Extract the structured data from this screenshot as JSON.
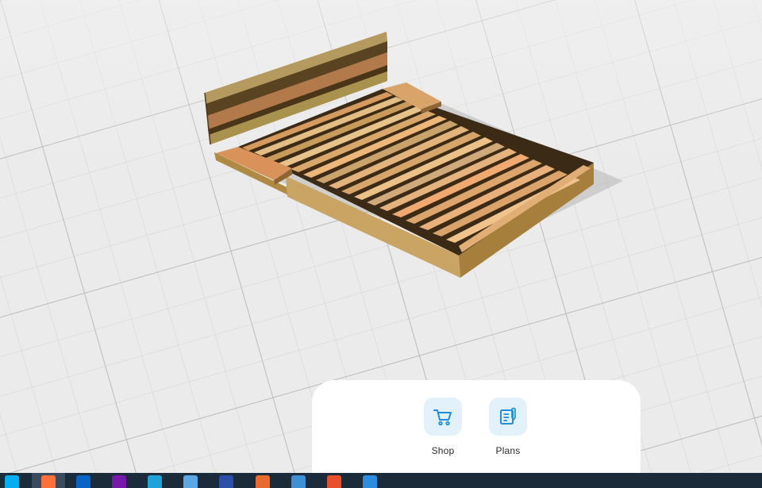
{
  "actions": {
    "shop_label": "Shop",
    "plans_label": "Plans"
  },
  "colors": {
    "accent": "#1f8ee0",
    "tile_bg": "#e3f1fb",
    "taskbar_bg": "#1c2b3a"
  },
  "taskbar_icons": [
    {
      "name": "skype-icon",
      "color": "#00aff0"
    },
    {
      "name": "firefox-icon",
      "color": "#ff7139"
    },
    {
      "name": "outlook-icon",
      "color": "#0a64c8"
    },
    {
      "name": "onenote-icon",
      "color": "#7719aa"
    },
    {
      "name": "edge-icon",
      "color": "#1fa2d8"
    },
    {
      "name": "notepad-icon",
      "color": "#5aa9e6"
    },
    {
      "name": "word-app-icon",
      "color": "#2b4fa8"
    },
    {
      "name": "media-player-icon",
      "color": "#e86a2c"
    },
    {
      "name": "photos-icon",
      "color": "#3d8fd6"
    },
    {
      "name": "snagit-icon",
      "color": "#e94f2a"
    },
    {
      "name": "snagit-editor-icon",
      "color": "#2a8de0"
    }
  ]
}
